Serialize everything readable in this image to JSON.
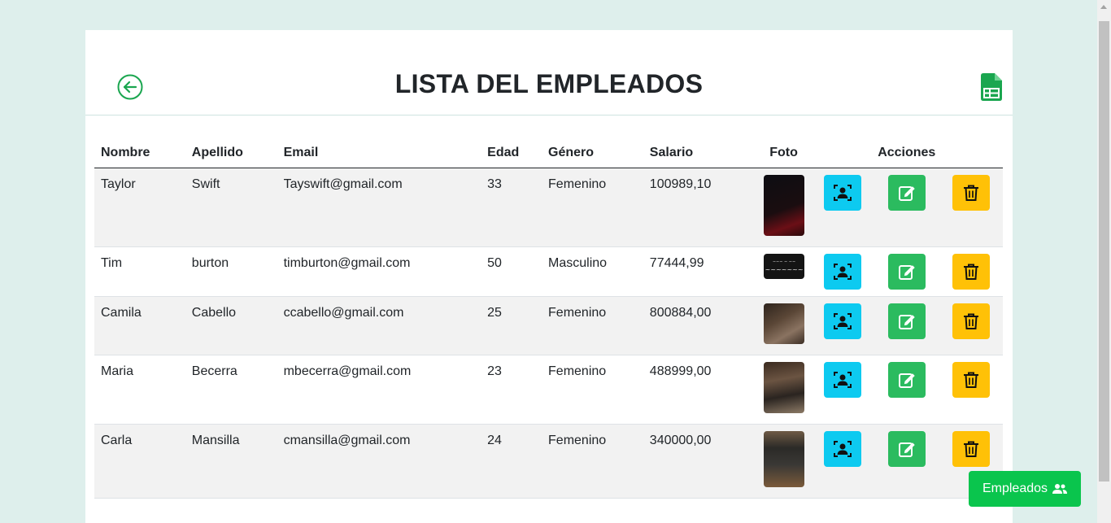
{
  "page": {
    "title": "LISTA DEL EMPLEADOS",
    "back_icon": "arrow-left-circle-icon",
    "export_icon": "spreadsheet-file-icon"
  },
  "table": {
    "headers": {
      "nombre": "Nombre",
      "apellido": "Apellido",
      "email": "Email",
      "edad": "Edad",
      "genero": "Género",
      "salario": "Salario",
      "foto": "Foto",
      "acciones": "Acciones"
    },
    "rows": [
      {
        "nombre": "Taylor",
        "apellido": "Swift",
        "email": "Tayswift@gmail.com",
        "edad": "33",
        "genero": "Femenino",
        "salario": "100989,10"
      },
      {
        "nombre": "Tim",
        "apellido": "burton",
        "email": "timburton@gmail.com",
        "edad": "50",
        "genero": "Masculino",
        "salario": "77444,99"
      },
      {
        "nombre": "Camila",
        "apellido": "Cabello",
        "email": "ccabello@gmail.com",
        "edad": "25",
        "genero": "Femenino",
        "salario": "800884,00"
      },
      {
        "nombre": "Maria",
        "apellido": "Becerra",
        "email": "mbecerra@gmail.com",
        "edad": "23",
        "genero": "Femenino",
        "salario": "488999,00"
      },
      {
        "nombre": "Carla",
        "apellido": "Mansilla",
        "email": "cmansilla@gmail.com",
        "edad": "24",
        "genero": "Femenino",
        "salario": "340000,00"
      }
    ],
    "action_icons": [
      "person-badge-icon",
      "edit-icon",
      "trash-icon"
    ]
  },
  "float_button": {
    "label": "Empleados",
    "icon": "people-icon"
  },
  "colors": {
    "background": "#deefec",
    "view": "#0dcaf0",
    "edit": "#2bbb5f",
    "delete": "#ffc107",
    "float": "#0ac54d",
    "brand_green": "#1aa64f"
  }
}
